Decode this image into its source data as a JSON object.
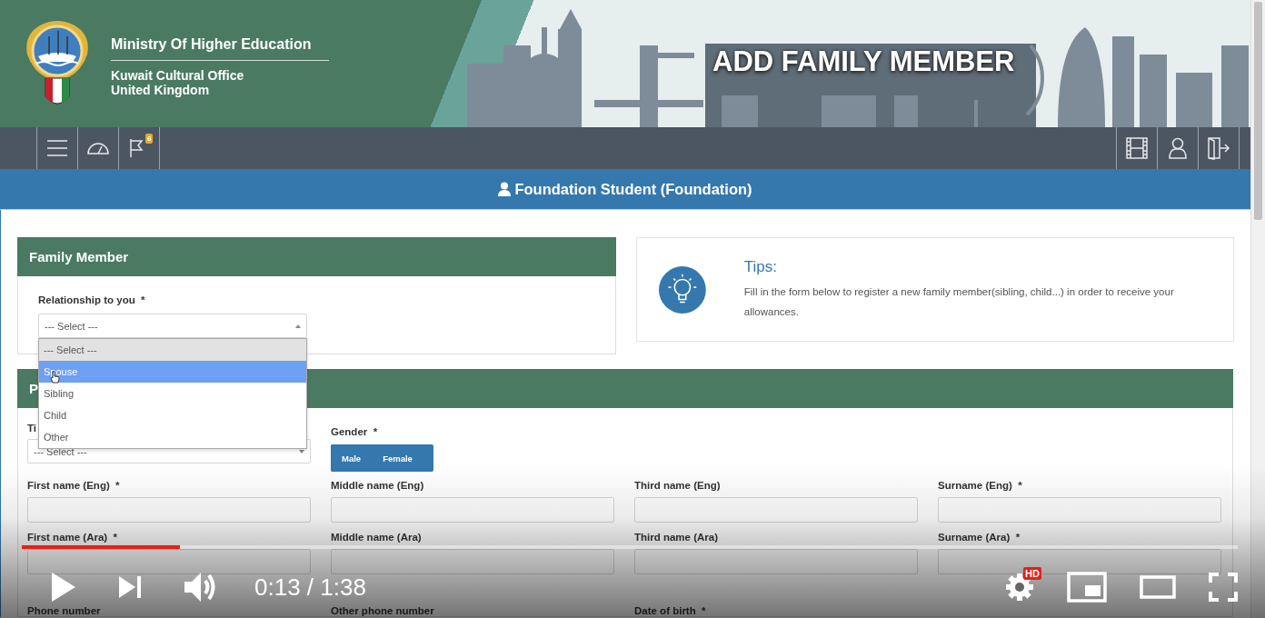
{
  "header": {
    "ministry": "Ministry Of Higher Education",
    "office_line_1": "Kuwait Cultural Office",
    "office_line_2": "United Kingdom",
    "page_title": "ADD FAMILY MEMBER"
  },
  "toolbar": {
    "flag_badge": "6"
  },
  "user_bar": {
    "label": "Foundation Student (Foundation)"
  },
  "family_member": {
    "title": "Family Member",
    "relationship": {
      "label": "Relationship to you  *",
      "value": "--- Select ---",
      "expanded": true,
      "options": [
        {
          "label": "--- Select ---",
          "selected": true,
          "highlighted": false
        },
        {
          "label": "Spouse",
          "selected": false,
          "highlighted": true
        },
        {
          "label": "Sibling",
          "selected": false,
          "highlighted": false
        },
        {
          "label": "Child",
          "selected": false,
          "highlighted": false
        },
        {
          "label": "Other",
          "selected": false,
          "highlighted": false
        }
      ]
    }
  },
  "tips": {
    "title": "Tips:",
    "text": "Fill in the form below to register a new family member(sibling, child...) in order to receive your allowances."
  },
  "personal": {
    "title": "P",
    "title_field": {
      "label": "Ti",
      "value": "--- Select ---"
    },
    "gender": {
      "label": "Gender  *",
      "options": [
        "Male",
        "Female"
      ]
    },
    "fields": [
      {
        "label": "First name (Eng)  *",
        "kind": "input"
      },
      {
        "label": "Middle name (Eng)",
        "kind": "input"
      },
      {
        "label": "Third name (Eng)",
        "kind": "input"
      },
      {
        "label": "Surname (Eng)  *",
        "kind": "input"
      },
      {
        "label": "First name (Ara)  *",
        "kind": "input"
      },
      {
        "label": "Middle name (Ara)",
        "kind": "input"
      },
      {
        "label": "Third name (Ara)",
        "kind": "input"
      },
      {
        "label": "Surname (Ara)  *",
        "kind": "input"
      },
      {
        "label": "Phone number",
        "kind": "label"
      },
      {
        "label": "Other phone number",
        "kind": "label"
      },
      {
        "label": "Date of birth  *",
        "kind": "label"
      }
    ]
  },
  "player": {
    "level": 0.13,
    "time": "0:13 / 1:38",
    "quality_badge": "HD"
  }
}
